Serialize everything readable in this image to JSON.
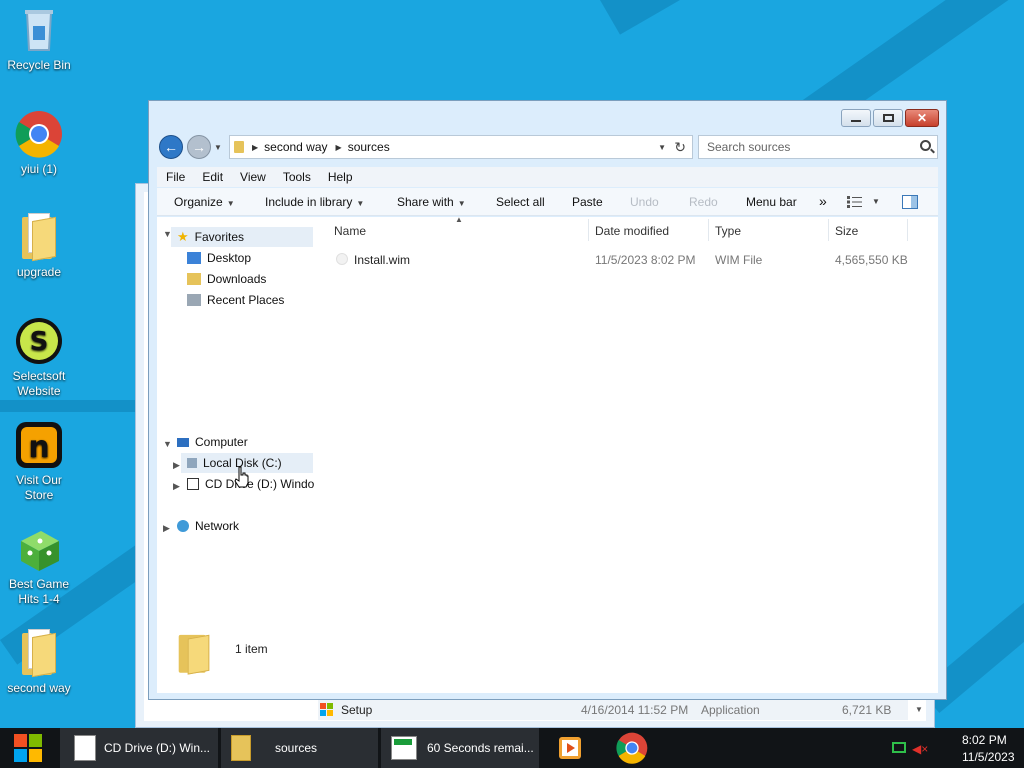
{
  "desktop": {
    "icons": [
      {
        "label": "Recycle Bin",
        "icon": "recycle-bin-icon"
      },
      {
        "label": "yiui (1)",
        "icon": "chrome-icon"
      },
      {
        "label": "upgrade",
        "icon": "folder-icon"
      },
      {
        "label": "Selectsoft Website",
        "icon": "selectsoft-icon"
      },
      {
        "label": "Visit Our Store",
        "icon": "store-icon"
      },
      {
        "label": "Best Game Hits 1-4",
        "icon": "dice-icon"
      },
      {
        "label": "second way",
        "icon": "folder-icon"
      }
    ],
    "background_color": "#1aa6e0"
  },
  "window": {
    "address": {
      "path": [
        "second way",
        "sources"
      ]
    },
    "search": {
      "placeholder": "Search sources"
    },
    "menu": [
      "File",
      "Edit",
      "View",
      "Tools",
      "Help"
    ],
    "toolbar": {
      "organize": "Organize",
      "include": "Include in library",
      "share": "Share with",
      "select_all": "Select all",
      "paste": "Paste",
      "undo": "Undo",
      "redo": "Redo",
      "menu_bar": "Menu bar",
      "more": "»"
    },
    "nav": {
      "favorites": "Favorites",
      "desktop": "Desktop",
      "downloads": "Downloads",
      "recent": "Recent Places",
      "computer": "Computer",
      "local_disk": "Local Disk (C:)",
      "cd_drive": "CD Drive (D:) Windo",
      "network": "Network"
    },
    "columns": {
      "name": "Name",
      "date": "Date modified",
      "type": "Type",
      "size": "Size"
    },
    "files": [
      {
        "name": "Install.wim",
        "date": "11/5/2023 8:02 PM",
        "type": "WIM File",
        "size": "4,565,550 KB"
      }
    ],
    "status": "1 item"
  },
  "background_window": {
    "row": {
      "name": "Setup",
      "date": "4/16/2014 11:52 PM",
      "type": "Application",
      "size": "6,721 KB"
    }
  },
  "taskbar": {
    "items": [
      {
        "label": "CD Drive (D:) Win..."
      },
      {
        "label": "sources"
      },
      {
        "label": "60 Seconds remai..."
      }
    ],
    "clock": {
      "time": "8:02 PM",
      "date": "11/5/2023"
    }
  }
}
